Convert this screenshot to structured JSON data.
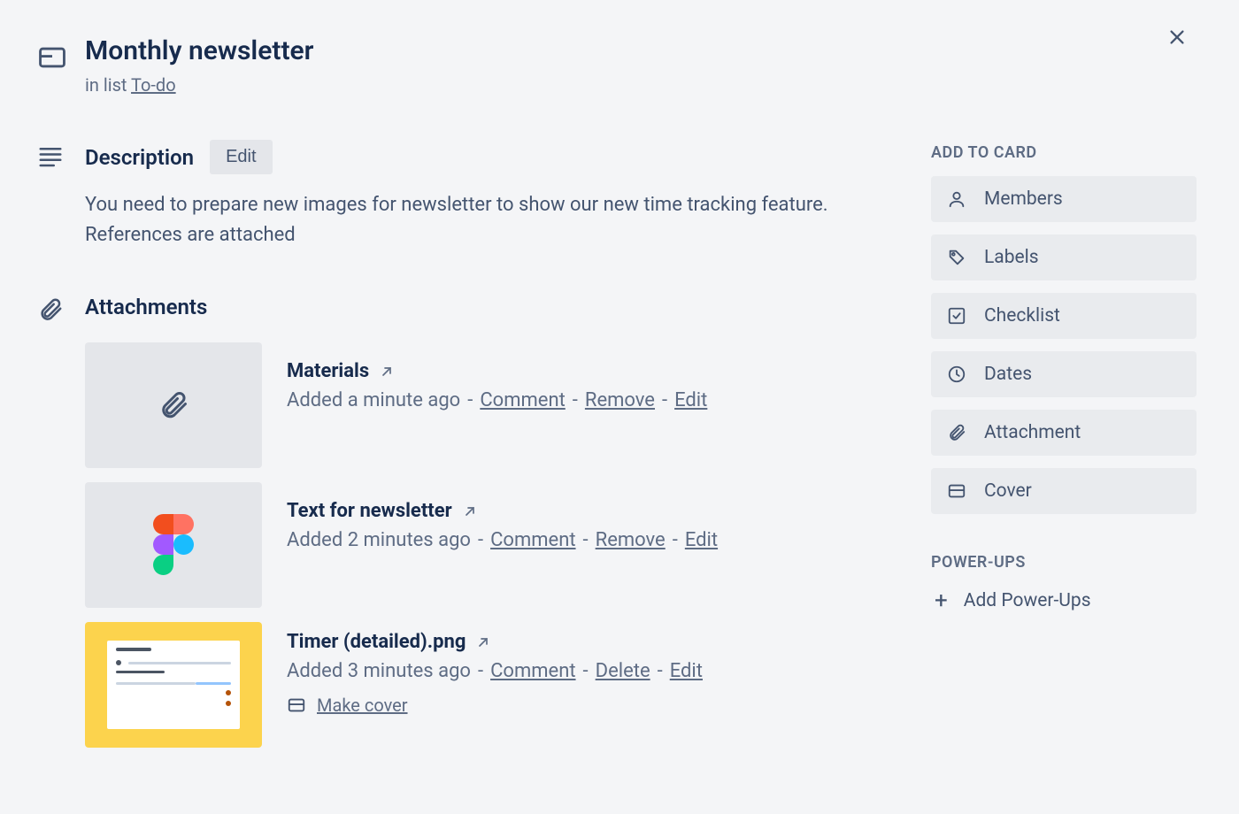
{
  "title": "Monthly newsletter",
  "subtitle_prefix": "in list ",
  "subtitle_link": "To-do",
  "description": {
    "heading": "Description",
    "edit_label": "Edit",
    "text": "You need to prepare new images for newsletter to show our new time tracking feature. References are attached"
  },
  "attachments": {
    "heading": "Attachments",
    "items": [
      {
        "name": "Materials",
        "added": "Added a minute ago",
        "actions": {
          "comment": "Comment",
          "remove": "Remove",
          "edit": "Edit"
        }
      },
      {
        "name": "Text for newsletter",
        "added": "Added 2 minutes ago",
        "actions": {
          "comment": "Comment",
          "remove": "Remove",
          "edit": "Edit"
        }
      },
      {
        "name": "Timer (detailed).png",
        "added": "Added 3 minutes ago",
        "actions": {
          "comment": "Comment",
          "remove": "Delete",
          "edit": "Edit"
        },
        "make_cover": "Make cover"
      }
    ]
  },
  "sidebar": {
    "add_to_card_heading": "ADD TO CARD",
    "buttons": {
      "members": "Members",
      "labels": "Labels",
      "checklist": "Checklist",
      "dates": "Dates",
      "attachment": "Attachment",
      "cover": "Cover"
    },
    "powerups_heading": "POWER-UPS",
    "add_powerups": "Add Power-Ups"
  }
}
